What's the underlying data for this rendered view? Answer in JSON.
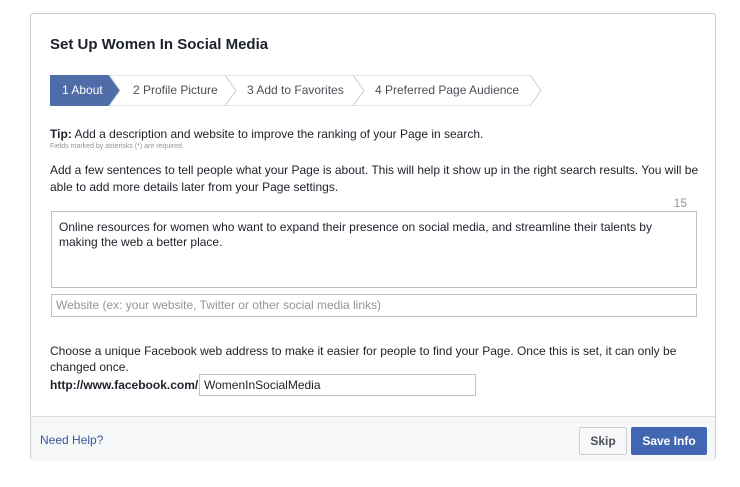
{
  "dialog": {
    "title": "Set Up Women In Social Media"
  },
  "steps": [
    {
      "label": "1 About",
      "active": true
    },
    {
      "label": "2 Profile Picture",
      "active": false
    },
    {
      "label": "3 Add to Favorites",
      "active": false
    },
    {
      "label": "4 Preferred Page Audience",
      "active": false
    }
  ],
  "tip": {
    "label": "Tip:",
    "text": " Add a description and website to improve the ranking of your Page in search.",
    "required_note": "Fields marked by asterisks (*) are required."
  },
  "about": {
    "instructions": "Add a few sentences to tell people what your Page is about. This will help it show up in the right search results. You will be able to add more details later from your Page settings.",
    "char_counter": "15",
    "description_value": "Online resources for women who want to expand their presence on social media, and streamline their talents by making the web a better place.",
    "website_placeholder": "Website (ex: your website, Twitter or other social media links)"
  },
  "address": {
    "instructions": "Choose a unique Facebook web address to make it easier for people to find your Page. Once this is set, it can only be changed once.",
    "prefix": "http://www.facebook.com/",
    "value": "WomenInSocialMedia"
  },
  "footer": {
    "help_link": "Need Help?",
    "skip_label": "Skip",
    "save_label": "Save Info"
  },
  "colors": {
    "active_step": "#4d6ca8",
    "primary_button": "#4267b2",
    "link": "#365899"
  }
}
